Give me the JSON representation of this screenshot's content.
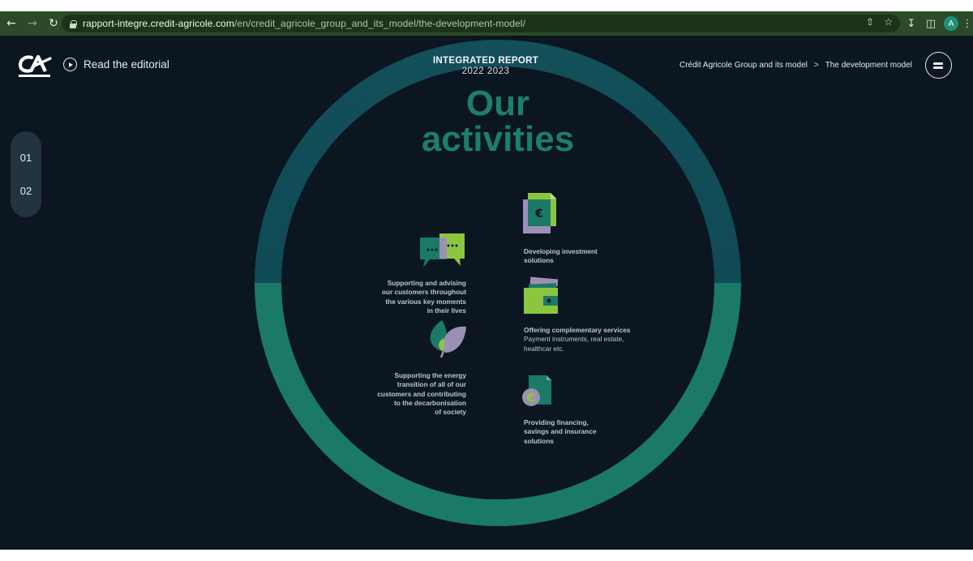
{
  "browser": {
    "url_domain": "rapport-integre.credit-agricole.com",
    "url_path": "/en/credit_agricole_group_and_its_model/the-development-model/",
    "avatar_letter": "A"
  },
  "header": {
    "editorial_label": "Read the editorial",
    "report_title": "INTEGRATED REPORT",
    "report_years": "2022 2023",
    "breadcrumb": {
      "parent": "Crédit Agricole Group and its model",
      "separator": ">",
      "current": "The development model"
    }
  },
  "sidenav": {
    "items": [
      "01",
      "02"
    ]
  },
  "main": {
    "title_line1": "Our",
    "title_line2": "activities",
    "activities": {
      "advising": {
        "lines": [
          "Supporting and advising",
          "our customers throughout",
          "the various key moments",
          "in their lives"
        ],
        "icon": "chat-bubbles-icon"
      },
      "energy": {
        "lines": [
          "Supporting the energy",
          "transition of all of our",
          "customers and contributing",
          "to the decarbonisation",
          "of society"
        ],
        "icon": "leaf-icon"
      },
      "investment": {
        "lines": [
          "Developing investment",
          "solutions"
        ],
        "icon": "euro-document-icon"
      },
      "services": {
        "lines": [
          "Offering complementary services"
        ],
        "sub_lines": [
          "Payment instruments, real estate,",
          "healthcar etc."
        ],
        "icon": "wallet-icon"
      },
      "financing": {
        "lines": [
          "Providing financing,",
          "savings and insurance",
          "solutions"
        ],
        "icon": "euro-coin-document-icon"
      }
    }
  },
  "colors": {
    "background": "#0b1620",
    "ring_top": "#0f4d57",
    "ring_bottom": "#1b7a67",
    "title": "#1c7f68",
    "accent_lime": "#8cc63f",
    "accent_lilac": "#9c8fb5",
    "accent_teal": "#1b7a67"
  }
}
